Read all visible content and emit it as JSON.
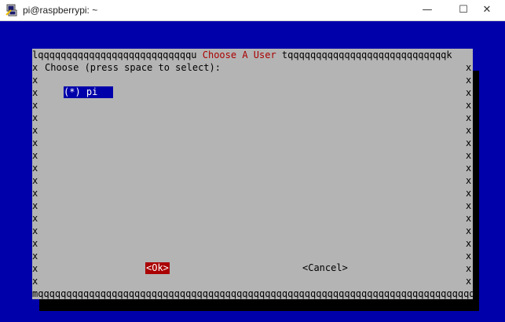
{
  "window": {
    "title": "pi@raspberrypi: ~",
    "minimize_glyph": "—",
    "maximize_glyph": "☐",
    "close_glyph": "✕"
  },
  "dialog": {
    "border_top_left": "lqqqqqqqqqqqqqqqqqqqqqqqqqqqu ",
    "title": "Choose A User",
    "border_top_right": " tqqqqqqqqqqqqqqqqqqqqqqqqqqqqk",
    "border_bottom": "mqqqqqqqqqqqqqqqqqqqqqqqqqqqqqqqqqqqqqqqqqqqqqqqqqqqqqqqqqqqqqqqqqqqqqqqqqqqqqqqqqqqqqqqqj",
    "side_char": "x",
    "prompt": "Choose (press space to select):",
    "items": [
      {
        "label": "(*) pi"
      }
    ],
    "ok_label": "<Ok>",
    "cancel_label": "<Cancel>"
  },
  "colors": {
    "terminal_bg": "#0000aa",
    "dialog_bg": "#b4b4b4",
    "title_color": "#aa0000",
    "selected_bg": "#0000aa",
    "ok_bg": "#aa0000"
  }
}
